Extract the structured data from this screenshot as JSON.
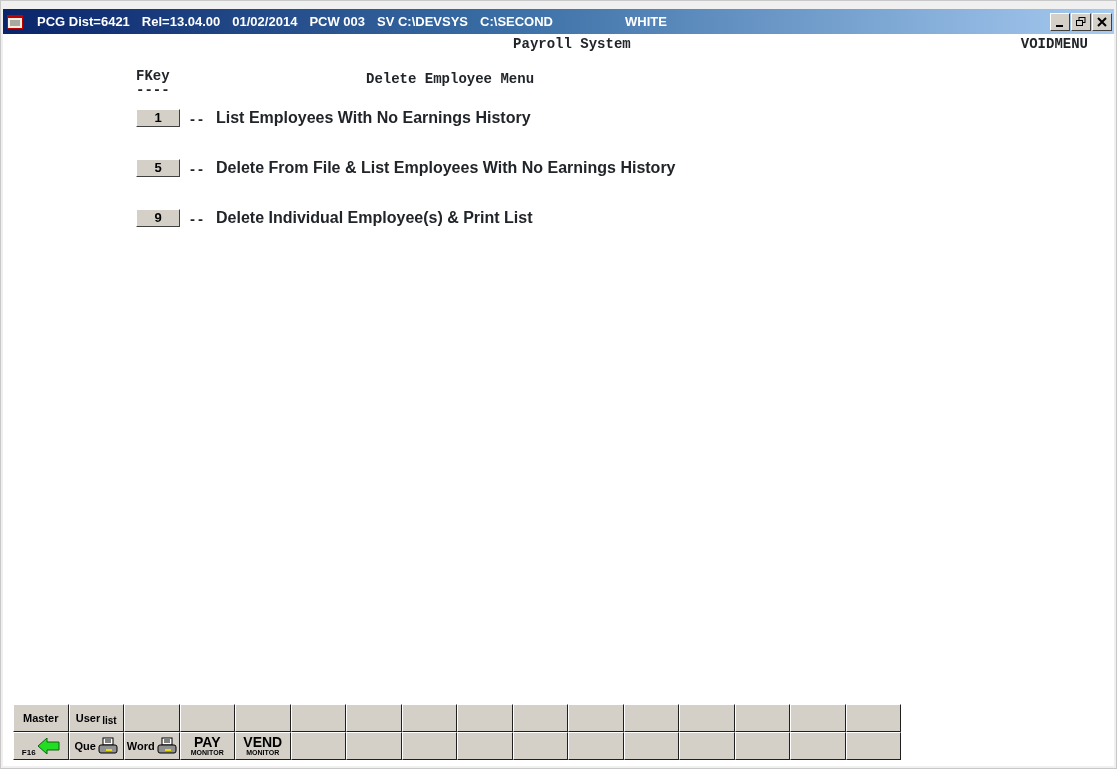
{
  "window": {
    "title_parts": [
      "PCG Dist=6421",
      "Rel=13.04.00",
      "01/02/2014",
      "PCW 003",
      "SV C:\\DEVSYS",
      "C:\\SECOND",
      "WHITE"
    ]
  },
  "header": {
    "system": "Payroll System",
    "screen_id": "VOIDMENU"
  },
  "menu": {
    "fkey_heading": "FKey",
    "fkey_rule": "----",
    "title": "Delete Employee Menu",
    "items": [
      {
        "key": "1",
        "separator": "--",
        "label": "List Employees With No Earnings History"
      },
      {
        "key": "5",
        "separator": "--",
        "label": "Delete From File & List Employees With No Earnings History"
      },
      {
        "key": "9",
        "separator": "--",
        "label": "Delete Individual Employee(s) & Print List"
      }
    ]
  },
  "toolbar": {
    "rows": [
      [
        {
          "kind": "text",
          "text": "Master"
        },
        {
          "kind": "text",
          "text": "User$_{list}$"
        },
        {
          "kind": "blank"
        },
        {
          "kind": "blank"
        },
        {
          "kind": "blank"
        },
        {
          "kind": "blank"
        },
        {
          "kind": "blank"
        },
        {
          "kind": "blank"
        },
        {
          "kind": "blank"
        },
        {
          "kind": "blank"
        },
        {
          "kind": "blank"
        },
        {
          "kind": "blank"
        },
        {
          "kind": "blank"
        },
        {
          "kind": "blank"
        },
        {
          "kind": "blank"
        },
        {
          "kind": "blank"
        }
      ],
      [
        {
          "kind": "arrow",
          "text": "F16"
        },
        {
          "kind": "printer",
          "text": "Que"
        },
        {
          "kind": "printer",
          "text": "Word"
        },
        {
          "kind": "monitor",
          "text": "PAY",
          "sub": "MONITOR"
        },
        {
          "kind": "monitor",
          "text": "VEND",
          "sub": "MONITOR"
        },
        {
          "kind": "blank"
        },
        {
          "kind": "blank"
        },
        {
          "kind": "blank"
        },
        {
          "kind": "blank"
        },
        {
          "kind": "blank"
        },
        {
          "kind": "blank"
        },
        {
          "kind": "blank"
        },
        {
          "kind": "blank"
        },
        {
          "kind": "blank"
        },
        {
          "kind": "blank"
        },
        {
          "kind": "blank"
        }
      ]
    ]
  }
}
